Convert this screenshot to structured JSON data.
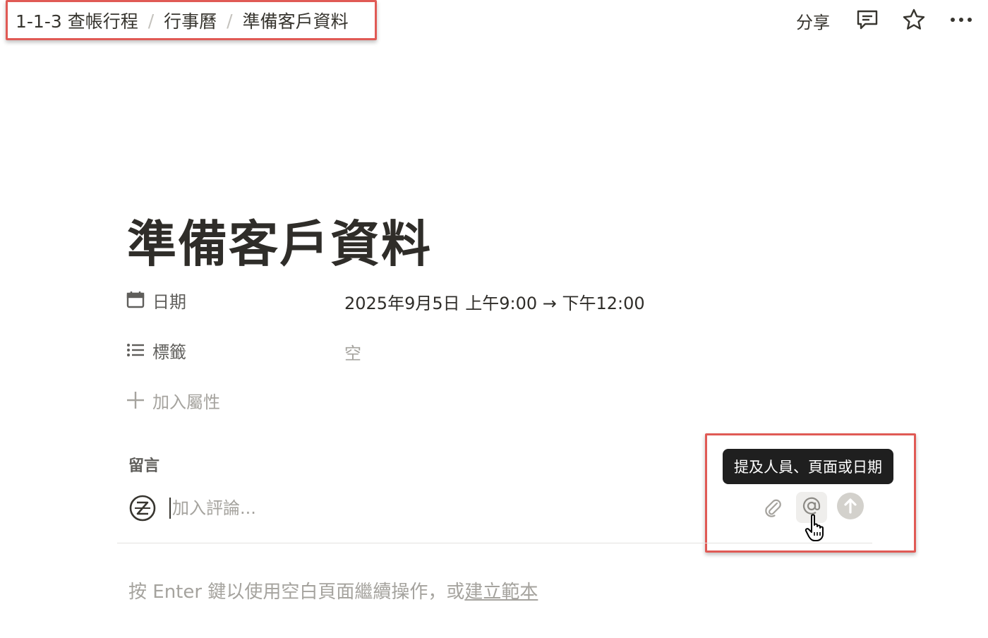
{
  "breadcrumb": {
    "items": [
      "1-1-3 查帳行程",
      "行事曆",
      "準備客戶資料"
    ],
    "separator": "/"
  },
  "topbar": {
    "share_label": "分享",
    "icons": [
      "comment-icon",
      "star-icon",
      "more-icon"
    ]
  },
  "page": {
    "title": "準備客戶資料"
  },
  "properties": [
    {
      "icon": "calendar-icon",
      "name": "日期",
      "value": "2025年9月5日 上午9:00 → 下午12:00"
    },
    {
      "icon": "list-icon",
      "name": "標籤",
      "value": "空"
    }
  ],
  "add_property_label": "加入屬性",
  "comments": {
    "label": "留言",
    "input_placeholder": "加入評論...",
    "input_value": "",
    "tooltip": "提及人員、頁面或日期",
    "tools": [
      "paperclip-icon",
      "mention-icon",
      "send-icon"
    ]
  },
  "hint": {
    "text": "按 Enter 鍵以使用空白頁面繼續操作，或",
    "link": "建立範本"
  },
  "colors": {
    "highlight": "#e05a55",
    "tooltip_bg": "#1f1f1f",
    "text": "#37352f",
    "muted": "#a5a39e"
  }
}
